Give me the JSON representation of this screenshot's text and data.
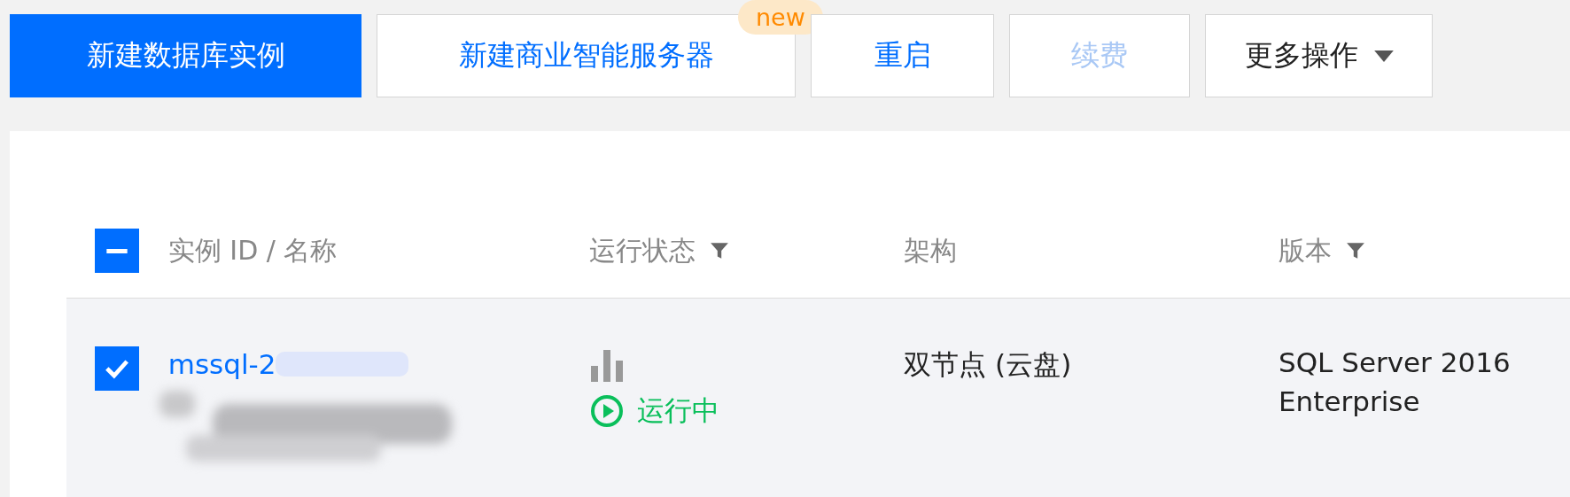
{
  "toolbar": {
    "buttons": [
      {
        "label": "新建数据库实例",
        "kind": "primary",
        "disabled": false
      },
      {
        "label": "新建商业智能服务器",
        "kind": "default",
        "disabled": false,
        "badge": "new"
      },
      {
        "label": "重启",
        "kind": "default",
        "disabled": false
      },
      {
        "label": "续费",
        "kind": "default",
        "disabled": true
      },
      {
        "label": "更多操作",
        "kind": "dropdown",
        "disabled": false
      }
    ]
  },
  "table": {
    "select_all": {
      "indeterminate": true
    },
    "columns": [
      {
        "label": "实例 ID / 名称",
        "filter": false
      },
      {
        "label": "运行状态",
        "filter": true
      },
      {
        "label": "架构",
        "filter": false
      },
      {
        "label": "版本",
        "filter": true
      }
    ],
    "rows": [
      {
        "selected": true,
        "checked": true,
        "id": "mssql-2",
        "status": "运行中",
        "running": true,
        "architecture": "双节点 (云盘)",
        "version": [
          "SQL Server 2016",
          "Enterprise"
        ]
      }
    ]
  }
}
